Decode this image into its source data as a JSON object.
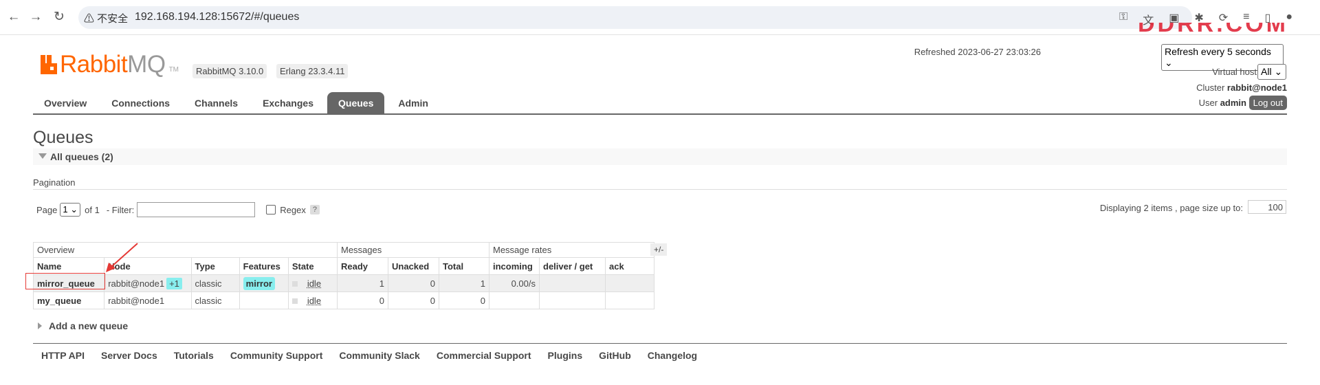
{
  "browser": {
    "back_icon": "←",
    "forward_icon": "→",
    "reload_icon": "↻",
    "security_label": "⚠ 不安全",
    "url": "192.168.194.128:15672/#/queues",
    "toolbar_icons": [
      "key-icon",
      "translate-icon",
      "extension-icon",
      "puzzle-icon",
      "sync-icon",
      "playlist-icon",
      "sidepanel-icon",
      "profile-icon"
    ]
  },
  "watermark_top": "DDRR.COM",
  "header": {
    "logo_rabbit": "Rabbit",
    "logo_mq": "MQ",
    "logo_tm": "TM",
    "rabbitmq_version": "RabbitMQ 3.10.0",
    "erlang_version": "Erlang 23.3.4.11",
    "refreshed_label": "Refreshed 2023-06-27 23:03:26",
    "refresh_select": "Refresh every 5 seconds",
    "vhost_label": "Virtual host",
    "vhost_value": "All",
    "cluster_label": "Cluster",
    "cluster_value": "rabbit@node1",
    "user_label": "User",
    "user_value": "admin",
    "logout_label": "Log out"
  },
  "tabs": [
    "Overview",
    "Connections",
    "Channels",
    "Exchanges",
    "Queues",
    "Admin"
  ],
  "active_tab": "Queues",
  "page_title": "Queues",
  "section_label": "All queues (2)",
  "pagination": {
    "title": "Pagination",
    "page_label": "Page",
    "page_value": "1",
    "of_label": "of 1",
    "filter_label": "- Filter:",
    "regex_label": "Regex",
    "help_label": "?",
    "display_label": "Displaying 2 items , page size up to:",
    "page_size": "100"
  },
  "table": {
    "groups": [
      "Overview",
      "Messages",
      "Message rates"
    ],
    "plus_minus": "+/-",
    "columns": [
      "Name",
      "Node",
      "Type",
      "Features",
      "State",
      "Ready",
      "Unacked",
      "Total",
      "incoming",
      "deliver / get",
      "ack"
    ],
    "rows": [
      {
        "name": "mirror_queue",
        "node": "rabbit@node1",
        "node_extra": "+1",
        "type": "classic",
        "features": "mirror",
        "state": "idle",
        "ready": "1",
        "unacked": "0",
        "total": "1",
        "incoming": "0.00/s",
        "deliver_get": "",
        "ack": ""
      },
      {
        "name": "my_queue",
        "node": "rabbit@node1",
        "node_extra": "",
        "type": "classic",
        "features": "",
        "state": "idle",
        "ready": "0",
        "unacked": "0",
        "total": "0",
        "incoming": "",
        "deliver_get": "",
        "ack": ""
      }
    ]
  },
  "add_queue_label": "Add a new queue",
  "footer_links": [
    "HTTP API",
    "Server Docs",
    "Tutorials",
    "Community Support",
    "Community Slack",
    "Commercial Support",
    "Plugins",
    "GitHub",
    "Changelog"
  ],
  "colors": {
    "brand": "#ff6600",
    "tab_active": "#666666",
    "highlight": "#88eeee",
    "annotation": "#e53935"
  }
}
